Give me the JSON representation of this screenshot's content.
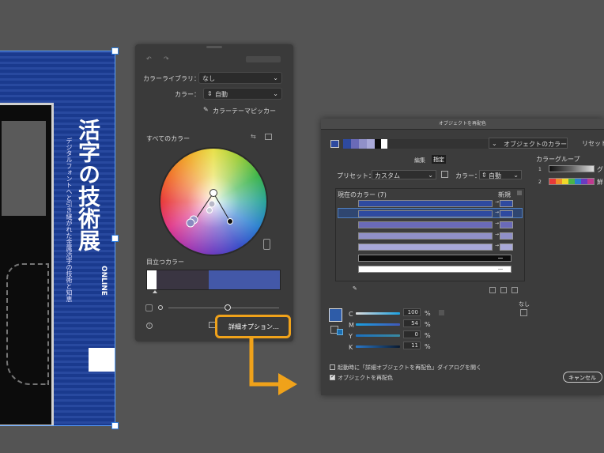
{
  "artwork": {
    "title": "活字の技術展",
    "subtitle": "デジタルフォントへと引き継がれた金属活字の技術と知恵",
    "online": "ONLINE"
  },
  "recolor_panel": {
    "library_label": "カラーライブラリ：",
    "library_value": "なし",
    "color_label": "カラー：",
    "color_value": "自動",
    "picker_label": "カラーテーマピッカー",
    "all_colors_label": "すべてのカラー",
    "prominent_label": "目立つカラー",
    "advanced_button": "詳細オプション…",
    "prominent_colors": [
      "#ffffff",
      "#3a3542",
      "#4358a8"
    ]
  },
  "dialog": {
    "title": "オブジェクトを再配色",
    "object_colors_label": "オブジェクトのカラー",
    "reset_button": "リセット",
    "tab_edit": "編集",
    "tab_assign": "指定",
    "preset_label": "プリセット：",
    "preset_value": "カスタム",
    "color_label": "カラー：",
    "color_value": "自動",
    "current_colors_label": "現在のカラー (7)",
    "new_label": "新規",
    "color_group_label": "カラーグループ",
    "group1_name": "グレ",
    "group2_name": "鮮ま",
    "none_label": "なし",
    "cmyk": [
      {
        "label": "C",
        "value": "100",
        "unit": "%"
      },
      {
        "label": "M",
        "value": "54",
        "unit": "%"
      },
      {
        "label": "Y",
        "value": "0",
        "unit": "%"
      },
      {
        "label": "K",
        "value": "11",
        "unit": "%"
      }
    ],
    "open_on_launch_label": "起動時に「詳細オブジェクトを再配色」ダイアログを開く",
    "recolor_art_label": "オブジェクトを再配色",
    "cancel_button": "キャンセル",
    "current_swatches": [
      "#2e4aa0",
      "#2e4aa0",
      "#6a6ab8",
      "#9090c8",
      "#a8a8d8",
      "#0c0c0c",
      "#ffffff"
    ]
  },
  "colors": {
    "accent_orange": "#f0a21a",
    "selection_blue": "#2f7fe0"
  }
}
